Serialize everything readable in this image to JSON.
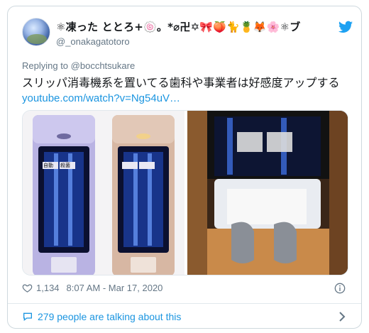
{
  "tweet": {
    "display_name": "⚛凍った ととろ+🍥。*⌀卍✡🎀🍑🐈🍍🦊🌸⚛ブ",
    "handle": "@_onakagatotoro",
    "replying_prefix": "Replying to",
    "replying_to": "@bocchtsukare",
    "text": "スリッパ消毒機系を置いてる歯科や事業者は好感度アップする",
    "link": "youtube.com/watch?v=Ng54uV…",
    "likes": "1,134",
    "timestamp": "8:07 AM - Mar 17, 2020",
    "talking_about": "279 people are talking about this"
  },
  "media": {
    "left_photo_label_1": "自動",
    "left_photo_label_2": "殺菌"
  },
  "colors": {
    "link": "#1b95e0",
    "muted": "#657786",
    "border": "#cfd9de",
    "twitter_blue": "#1da1f2"
  },
  "icons": [
    "twitter-logo-icon",
    "heart-icon",
    "info-icon",
    "comment-icon",
    "chevron-right-icon"
  ]
}
